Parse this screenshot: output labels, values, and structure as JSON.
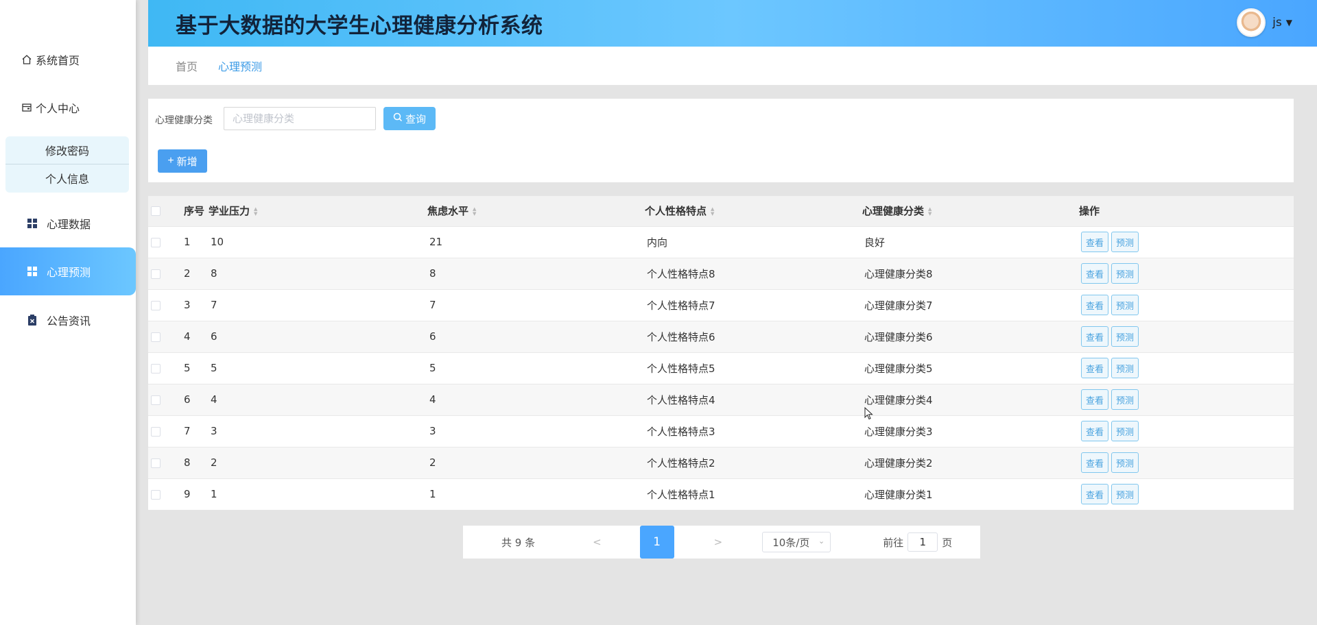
{
  "app": {
    "title": "基于大数据的大学生心理健康分析系统",
    "user": "js"
  },
  "sidebar": {
    "items": [
      {
        "label": "系统首页",
        "icon": "home-icon"
      },
      {
        "label": "个人中心",
        "icon": "wallet-icon"
      },
      {
        "label": "心理数据",
        "icon": "grid-icon"
      },
      {
        "label": "心理预测",
        "icon": "grid-icon"
      },
      {
        "label": "公告资讯",
        "icon": "clipboard-icon"
      }
    ],
    "submenu": [
      {
        "label": "修改密码"
      },
      {
        "label": "个人信息"
      }
    ]
  },
  "breadcrumb": {
    "home": "首页",
    "current": "心理预测"
  },
  "search": {
    "label": "心理健康分类",
    "placeholder": "心理健康分类",
    "query_label": "查询",
    "add_label": "新增"
  },
  "table": {
    "headers": {
      "no": "序号",
      "pressure": "学业压力",
      "anxiety": "焦虑水平",
      "personality": "个人性格特点",
      "category": "心理健康分类",
      "ops": "操作"
    },
    "view_label": "查看",
    "predict_label": "预测",
    "rows": [
      {
        "no": "1",
        "pressure": "10",
        "anxiety": "21",
        "personality": "内向",
        "category": "良好"
      },
      {
        "no": "2",
        "pressure": "8",
        "anxiety": "8",
        "personality": "个人性格特点8",
        "category": "心理健康分类8"
      },
      {
        "no": "3",
        "pressure": "7",
        "anxiety": "7",
        "personality": "个人性格特点7",
        "category": "心理健康分类7"
      },
      {
        "no": "4",
        "pressure": "6",
        "anxiety": "6",
        "personality": "个人性格特点6",
        "category": "心理健康分类6"
      },
      {
        "no": "5",
        "pressure": "5",
        "anxiety": "5",
        "personality": "个人性格特点5",
        "category": "心理健康分类5"
      },
      {
        "no": "6",
        "pressure": "4",
        "anxiety": "4",
        "personality": "个人性格特点4",
        "category": "心理健康分类4"
      },
      {
        "no": "7",
        "pressure": "3",
        "anxiety": "3",
        "personality": "个人性格特点3",
        "category": "心理健康分类3"
      },
      {
        "no": "8",
        "pressure": "2",
        "anxiety": "2",
        "personality": "个人性格特点2",
        "category": "心理健康分类2"
      },
      {
        "no": "9",
        "pressure": "1",
        "anxiety": "1",
        "personality": "个人性格特点1",
        "category": "心理健康分类1"
      }
    ]
  },
  "pagination": {
    "total": "共 9 条",
    "prev": "<",
    "next": ">",
    "current": "1",
    "page_size": "10条/页",
    "goto_label": "前往",
    "goto_value": "1",
    "page_unit": "页"
  },
  "colors": {
    "accent": "#4aa6ff",
    "header_start": "#3fb8f4",
    "header_end": "#4aa6ff"
  }
}
